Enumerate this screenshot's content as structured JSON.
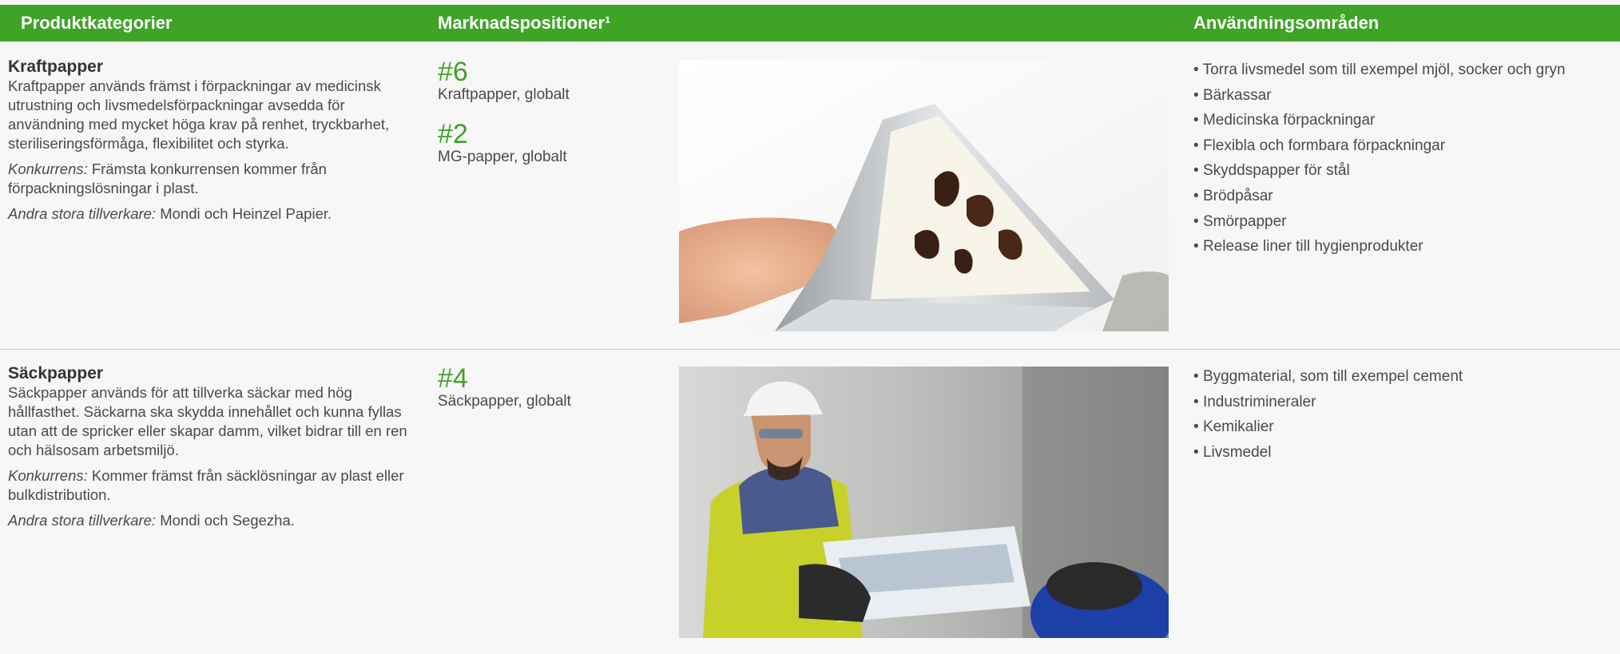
{
  "header": {
    "col1": "Produktkategorier",
    "col2": "Marknadspositioner¹",
    "col3": "Användningsområden"
  },
  "rows": [
    {
      "title": "Kraftpapper",
      "description": "Kraftpapper används främst i förpackningar av medicinsk utrustning och livsmedelsförpackningar avsedda för användning med mycket höga krav på renhet, tryckbarhet, steriliseringsförmåga, flexibilitet och styrka.",
      "competition_label": "Konkurrens:",
      "competition_text": " Främsta konkurrensen kommer från förpackningslösningar i plast.",
      "makers_label": "Andra stora tillverkare:",
      "makers_text": " Mondi och Heinzel Papier.",
      "ranks": [
        {
          "num": "#6",
          "label": "Kraftpapper, globalt"
        },
        {
          "num": "#2",
          "label": "MG-papper, globalt"
        }
      ],
      "uses": [
        "Torra livsmedel som till exempel mjöl, socker och gryn",
        "Bärkassar",
        "Medicinska förpackningar",
        "Flexibla och formbara förpackningar",
        "Skyddspapper för stål",
        "Brödpåsar",
        "Smörpapper",
        "Release liner till hygienprodukter"
      ]
    },
    {
      "title": "Säckpapper",
      "description": "Säckpapper används för att tillverka säckar med hög hållfasthet. Säckarna ska skydda innehållet och kunna fyllas utan att de spricker eller skapar damm, vilket bidrar till en ren och hälsosam arbetsmiljö.",
      "competition_label": "Konkurrens:",
      "competition_text": " Kommer främst från säcklösningar av plast eller bulkdistribution.",
      "makers_label": "Andra stora tillverkare:",
      "makers_text": " Mondi och Segezha.",
      "ranks": [
        {
          "num": "#4",
          "label": "Säckpapper, globalt"
        }
      ],
      "uses": [
        "Byggmaterial, som till exempel cement",
        "Industrimineraler",
        "Kemikalier",
        "Livsmedel"
      ]
    }
  ],
  "colors": {
    "accent": "#3fa328",
    "text": "#4a4a4a",
    "background": "#f7f7f7"
  }
}
